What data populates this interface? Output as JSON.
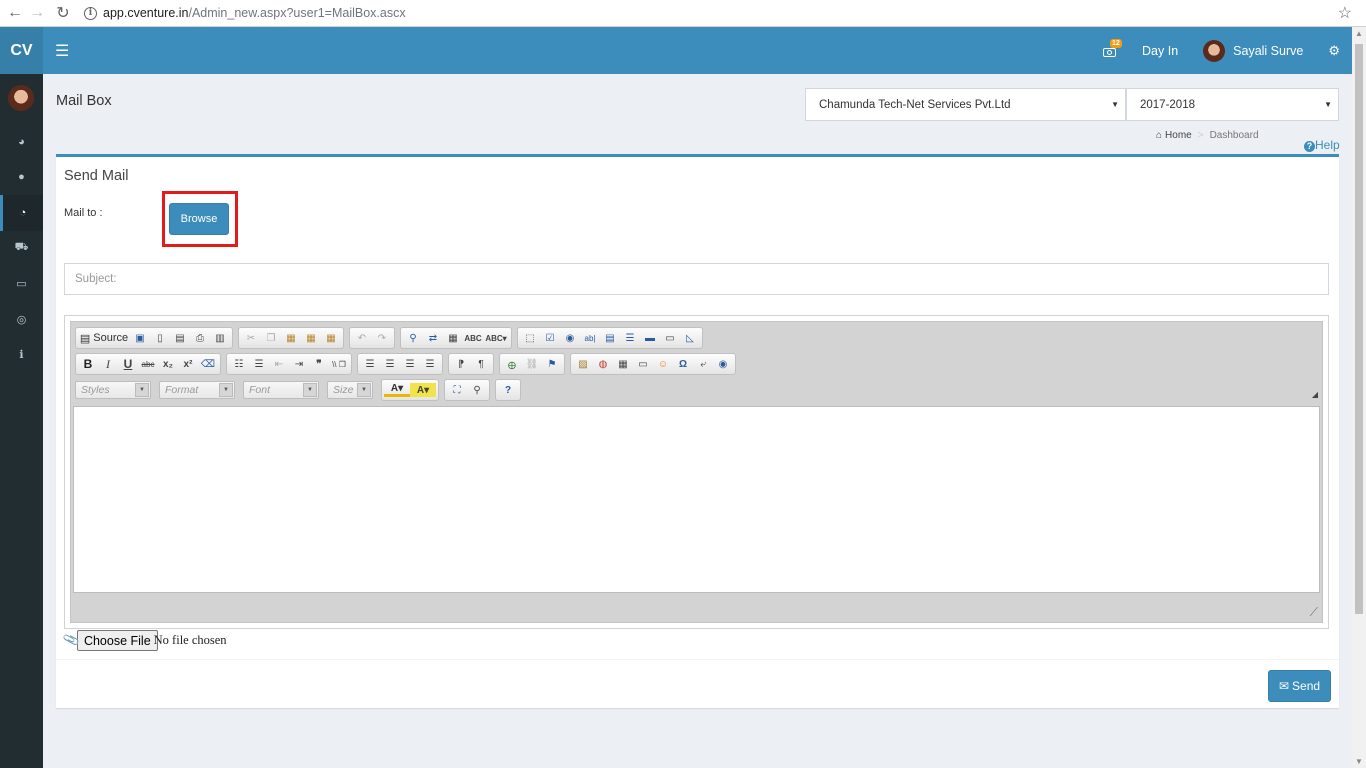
{
  "browser": {
    "url_host": "app.cventure.in",
    "url_path": "/Admin_new.aspx?user1=MailBox.ascx"
  },
  "header": {
    "logo": "CV",
    "notification_count": "12",
    "day_in": "Day In",
    "user_name": "Sayali Surve"
  },
  "sidebar": {
    "items": [
      {
        "icon": "dashboard-icon"
      },
      {
        "icon": "user-icon"
      },
      {
        "icon": "pie-chart-icon",
        "active": true
      },
      {
        "icon": "cart-icon"
      },
      {
        "icon": "credit-card-icon"
      },
      {
        "icon": "support-icon"
      },
      {
        "icon": "info-icon"
      }
    ]
  },
  "page": {
    "title": "Mail Box",
    "company_select": "Chamunda Tech-Net Services Pvt.Ltd",
    "year_select": "2017-2018",
    "breadcrumb_home": "Home",
    "breadcrumb_current": "Dashboard",
    "help": "Help"
  },
  "form": {
    "box_title": "Send Mail",
    "mail_to_label": "Mail to :",
    "browse_label": "Browse",
    "subject_placeholder": "Subject:",
    "choose_file_label": "Choose File",
    "no_file_text": "No file chosen",
    "send_label": "Send"
  },
  "editor": {
    "source_label": "Source",
    "combos": [
      "Styles",
      "Format",
      "Font",
      "Size"
    ]
  },
  "colors": {
    "header": "#3c8dbc",
    "sidebar": "#222d32",
    "highlight": "#e41b1b"
  }
}
